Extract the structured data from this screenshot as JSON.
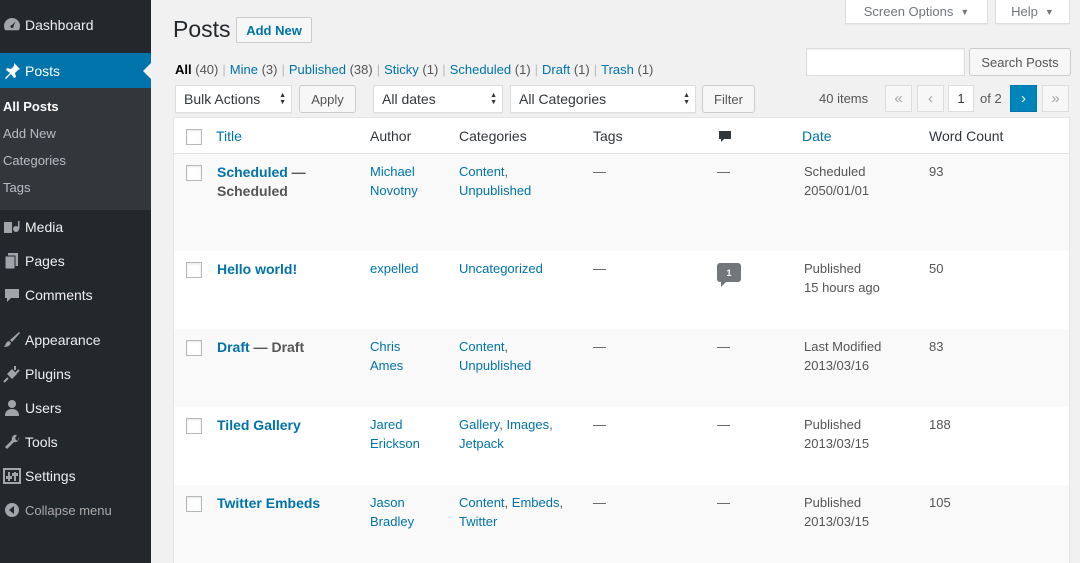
{
  "sidebar": {
    "dashboard": "Dashboard",
    "posts": "Posts",
    "submenu": [
      "All Posts",
      "Add New",
      "Categories",
      "Tags"
    ],
    "media": "Media",
    "pages": "Pages",
    "comments": "Comments",
    "appearance": "Appearance",
    "plugins": "Plugins",
    "users": "Users",
    "tools": "Tools",
    "settings": "Settings",
    "collapse": "Collapse menu"
  },
  "header": {
    "title": "Posts",
    "add_new": "Add New",
    "screen_options": "Screen Options",
    "help": "Help"
  },
  "views": [
    {
      "label": "All",
      "count": "(40)"
    },
    {
      "label": "Mine",
      "count": "(3)"
    },
    {
      "label": "Published",
      "count": "(38)"
    },
    {
      "label": "Sticky",
      "count": "(1)"
    },
    {
      "label": "Scheduled",
      "count": "(1)"
    },
    {
      "label": "Draft",
      "count": "(1)"
    },
    {
      "label": "Trash",
      "count": "(1)"
    }
  ],
  "search": {
    "placeholder": "",
    "button": "Search Posts"
  },
  "toolbar": {
    "bulk_actions": "Bulk Actions",
    "apply": "Apply",
    "dates": "All dates",
    "categories": "All Categories",
    "filter": "Filter",
    "items": "40 items",
    "page": "1",
    "of_pages": "of 2"
  },
  "pagination": {
    "first": "«",
    "prev": "‹",
    "next": "›",
    "last": "»"
  },
  "columns": {
    "title": "Title",
    "author": "Author",
    "categories": "Categories",
    "tags": "Tags",
    "date": "Date",
    "word_count": "Word Count"
  },
  "rows": [
    {
      "title": "Scheduled",
      "state": "Scheduled",
      "author1": "Michael",
      "author2": "Novotny",
      "cat1": "Content",
      "cat1_sep": ",",
      "cat2": "Unpublished",
      "cat3": "",
      "cat3_sep": "",
      "tags": "—",
      "comments": "—",
      "date_status": "Scheduled",
      "date": "2050/01/01",
      "words": "93"
    },
    {
      "title": "Hello world!",
      "state": "",
      "author1": "expelled",
      "author2": "",
      "cat1": "Uncategorized",
      "cat1_sep": "",
      "cat2": "",
      "cat3": "",
      "cat3_sep": "",
      "tags": "—",
      "comments": "1",
      "date_status": "Published",
      "date": "15 hours ago",
      "words": "50"
    },
    {
      "title": "Draft",
      "state": "Draft",
      "author1": "Chris",
      "author2": "Ames",
      "cat1": "Content",
      "cat1_sep": ",",
      "cat2": "Unpublished",
      "cat3": "",
      "cat3_sep": "",
      "tags": "—",
      "comments": "—",
      "date_status": "Last Modified",
      "date": "2013/03/16",
      "words": "83"
    },
    {
      "title": "Tiled Gallery",
      "state": "",
      "author1": "Jared",
      "author2": "Erickson",
      "cat1": "Gallery",
      "cat1_sep": ",",
      "cat2": "Images",
      "cat2_sep": ",",
      "cat3": "Jetpack",
      "tags": "—",
      "comments": "—",
      "date_status": "Published",
      "date": "2013/03/15",
      "words": "188"
    },
    {
      "title": "Twitter Embeds",
      "state": "",
      "author1": "Jason",
      "author2": "Bradley",
      "cat1": "Content",
      "cat1_sep": ",",
      "cat2": "Embeds",
      "cat2_sep": ",",
      "cat3": "Twitter",
      "tags": "—",
      "comments": "—",
      "date_status": "Published",
      "date": "2013/03/15",
      "words": "105"
    }
  ],
  "colors": {
    "sidebar": "#23282d",
    "active": "#0073aa",
    "link": "#0073aa"
  }
}
